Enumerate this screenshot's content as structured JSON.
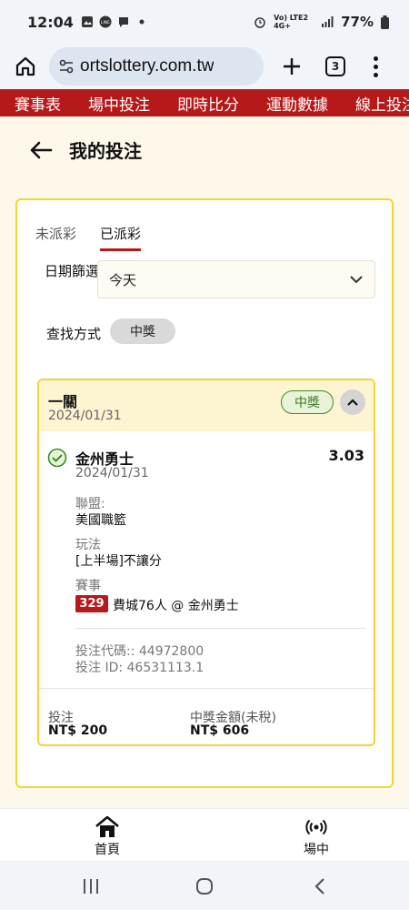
{
  "status_bar": {
    "time": "12:04",
    "signal": "Vo) LTE2 4G+",
    "battery": "77%"
  },
  "browser": {
    "url": "ortslottery.com.tw",
    "tab_count": "3"
  },
  "nav_strip": {
    "items": [
      "賽事表",
      "場中投注",
      "即時比分",
      "運動數據",
      "線上投注"
    ]
  },
  "page": {
    "title": "我的投注"
  },
  "tabs": {
    "unsettled": "未派彩",
    "settled": "已派彩"
  },
  "filters": {
    "date_label": "日期篩選",
    "date_value": "今天",
    "search_label": "查找方式",
    "search_value": "中獎"
  },
  "bet": {
    "type": "一關",
    "date": "2024/01/31",
    "status": "中獎",
    "selection": "金州勇士",
    "odds": "3.03",
    "event_date": "2024/01/31",
    "league_label": "聯盟:",
    "league_value": "美國職籃",
    "market_label": "玩法",
    "market_value": "[上半場]不讓分",
    "match_label": "賽事",
    "match_id": "329",
    "match_name": "費城76人 @ 金州勇士",
    "bet_code": "投注代碼:: 44972800",
    "bet_id": "投注 ID: 46531113.1",
    "stake_label": "投注",
    "stake_value": "NT$ 200",
    "payout_label": "中獎金額(未稅)",
    "payout_value": "NT$ 606"
  },
  "bottom_nav": {
    "home": "首頁",
    "live": "場中"
  },
  "colors": {
    "brand_red": "#b5191a",
    "accent_yellow": "#f2d534",
    "win_green": "#3b8b2c"
  }
}
